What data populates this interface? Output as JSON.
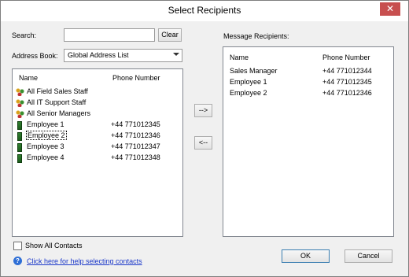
{
  "window": {
    "title": "Select Recipients",
    "close_label": "✕"
  },
  "left": {
    "search_label": "Search:",
    "search_value": "",
    "clear_label": "Clear",
    "address_book_label": "Address Book:",
    "address_book_selected": "Global Address List",
    "list": {
      "headers": [
        "Name",
        "Phone Number"
      ],
      "rows": [
        {
          "name": "All Field Sales Staff",
          "phone": "",
          "icon": "group-icon"
        },
        {
          "name": "All IT Support Staff",
          "phone": "",
          "icon": "group-icon"
        },
        {
          "name": "All Senior Managers",
          "phone": "",
          "icon": "group-icon"
        },
        {
          "name": "Employee 1",
          "phone": "+44 771012345",
          "icon": "phone-contact-icon"
        },
        {
          "name": "Employee 2",
          "phone": "+44 771012346",
          "icon": "phone-contact-icon"
        },
        {
          "name": "Employee 3",
          "phone": "+44 771012347",
          "icon": "phone-contact-icon"
        },
        {
          "name": "Employee 4",
          "phone": "+44 771012348",
          "icon": "phone-contact-icon"
        }
      ]
    },
    "show_all_contacts_label": "Show All Contacts",
    "help_link": "Click here for help selecting contacts"
  },
  "middle": {
    "add_label": "-->",
    "remove_label": "<--"
  },
  "right": {
    "title": "Message Recipients:",
    "headers": [
      "Name",
      "Phone Number"
    ],
    "rows": [
      {
        "name": "Sales Manager",
        "phone": "+44 771012344"
      },
      {
        "name": "Employee 1",
        "phone": "+44 771012345"
      },
      {
        "name": "Employee 2",
        "phone": "+44 771012346"
      }
    ]
  },
  "footer": {
    "ok_label": "OK",
    "cancel_label": "Cancel"
  }
}
